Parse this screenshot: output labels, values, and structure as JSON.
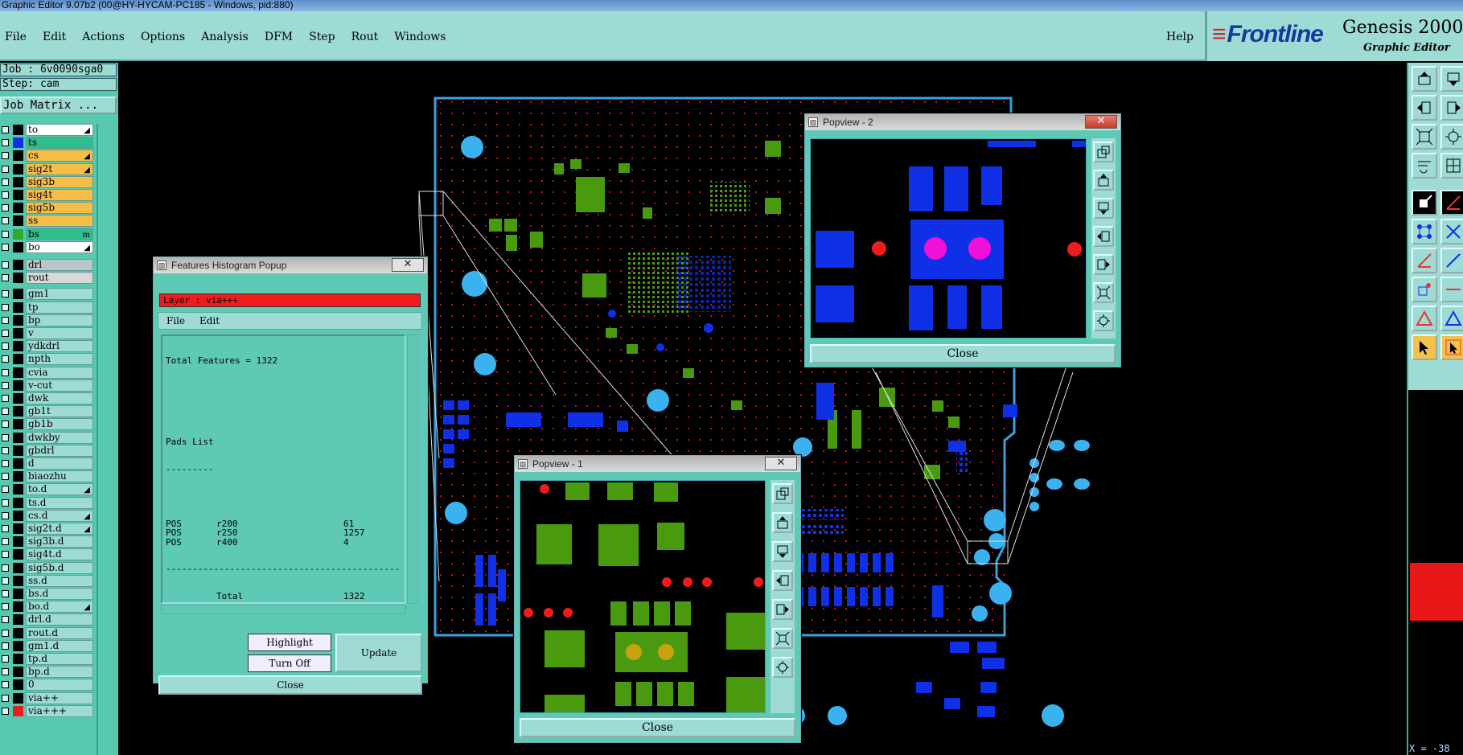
{
  "window": {
    "title": "Graphic Editor 9.07b2 (00@HY-HYCAM-PC185 - Windows, pid:880)"
  },
  "menu": {
    "items": [
      "File",
      "Edit",
      "Actions",
      "Options",
      "Analysis",
      "DFM",
      "Step",
      "Rout",
      "Windows"
    ],
    "help": "Help"
  },
  "branding": {
    "logo": "Frontline",
    "product": "Genesis 2000",
    "subtitle": "Graphic Editor"
  },
  "job": {
    "job_label": "Job : 6v0090sga0",
    "step_label": "Step: cam",
    "matrix_button": "Job Matrix ..."
  },
  "layers": [
    {
      "name": "to",
      "color": "#000000",
      "name_bg": "#ffffff",
      "mark": "◢"
    },
    {
      "name": "ts",
      "color": "#1030e8",
      "name_bg": "#2ebd8b",
      "mark": ""
    },
    {
      "name": "cs",
      "color": "#000000",
      "name_bg": "#f7be46",
      "mark": "◢"
    },
    {
      "name": "sig2t",
      "color": "#000000",
      "name_bg": "#f7be46",
      "mark": "◢"
    },
    {
      "name": "sig3b",
      "color": "#000000",
      "name_bg": "#f7be46",
      "mark": ""
    },
    {
      "name": "sig4t",
      "color": "#000000",
      "name_bg": "#f7be46",
      "mark": ""
    },
    {
      "name": "sig5b",
      "color": "#000000",
      "name_bg": "#f7be46",
      "mark": ""
    },
    {
      "name": "ss",
      "color": "#000000",
      "name_bg": "#f7be46",
      "mark": ""
    },
    {
      "name": "bs",
      "color": "#2eaa2e",
      "name_bg": "#2ebd8b",
      "mark": "m"
    },
    {
      "name": "bo",
      "color": "#000000",
      "name_bg": "#ffffff",
      "mark": "◢"
    },
    {
      "name": "drl",
      "color": "#000000",
      "name_bg": "#b8c8c8",
      "mark": ""
    },
    {
      "name": "rout",
      "color": "#000000",
      "name_bg": "#d8d8d8",
      "mark": ""
    },
    {
      "name": "gm1",
      "color": "#000000",
      "name_bg": "#9edbd4",
      "mark": ""
    },
    {
      "name": "tp",
      "color": "#000000",
      "name_bg": "#9edbd4",
      "mark": ""
    },
    {
      "name": "bp",
      "color": "#000000",
      "name_bg": "#9edbd4",
      "mark": ""
    },
    {
      "name": "v",
      "color": "#000000",
      "name_bg": "#9edbd4",
      "mark": ""
    },
    {
      "name": "ydkdrl",
      "color": "#000000",
      "name_bg": "#9edbd4",
      "mark": ""
    },
    {
      "name": "npth",
      "color": "#000000",
      "name_bg": "#9edbd4",
      "mark": ""
    },
    {
      "name": "cvia",
      "color": "#000000",
      "name_bg": "#9edbd4",
      "mark": ""
    },
    {
      "name": "v-cut",
      "color": "#000000",
      "name_bg": "#9edbd4",
      "mark": ""
    },
    {
      "name": "dwk",
      "color": "#000000",
      "name_bg": "#9edbd4",
      "mark": ""
    },
    {
      "name": "gb1t",
      "color": "#000000",
      "name_bg": "#9edbd4",
      "mark": ""
    },
    {
      "name": "gb1b",
      "color": "#000000",
      "name_bg": "#9edbd4",
      "mark": ""
    },
    {
      "name": "dwkby",
      "color": "#000000",
      "name_bg": "#9edbd4",
      "mark": ""
    },
    {
      "name": "gbdrl",
      "color": "#000000",
      "name_bg": "#9edbd4",
      "mark": ""
    },
    {
      "name": "d",
      "color": "#000000",
      "name_bg": "#9edbd4",
      "mark": ""
    },
    {
      "name": "biaozhu",
      "color": "#000000",
      "name_bg": "#9edbd4",
      "mark": ""
    },
    {
      "name": "to.d",
      "color": "#000000",
      "name_bg": "#9edbd4",
      "mark": "◢"
    },
    {
      "name": "ts.d",
      "color": "#000000",
      "name_bg": "#9edbd4",
      "mark": ""
    },
    {
      "name": "cs.d",
      "color": "#000000",
      "name_bg": "#9edbd4",
      "mark": "◢"
    },
    {
      "name": "sig2t.d",
      "color": "#000000",
      "name_bg": "#9edbd4",
      "mark": "◢"
    },
    {
      "name": "sig3b.d",
      "color": "#000000",
      "name_bg": "#9edbd4",
      "mark": ""
    },
    {
      "name": "sig4t.d",
      "color": "#000000",
      "name_bg": "#9edbd4",
      "mark": ""
    },
    {
      "name": "sig5b.d",
      "color": "#000000",
      "name_bg": "#9edbd4",
      "mark": ""
    },
    {
      "name": "ss.d",
      "color": "#000000",
      "name_bg": "#9edbd4",
      "mark": ""
    },
    {
      "name": "bs.d",
      "color": "#000000",
      "name_bg": "#9edbd4",
      "mark": ""
    },
    {
      "name": "bo.d",
      "color": "#000000",
      "name_bg": "#9edbd4",
      "mark": "◢"
    },
    {
      "name": "drl.d",
      "color": "#000000",
      "name_bg": "#9edbd4",
      "mark": ""
    },
    {
      "name": "rout.d",
      "color": "#000000",
      "name_bg": "#9edbd4",
      "mark": ""
    },
    {
      "name": "gm1.d",
      "color": "#000000",
      "name_bg": "#9edbd4",
      "mark": ""
    },
    {
      "name": "tp.d",
      "color": "#000000",
      "name_bg": "#9edbd4",
      "mark": ""
    },
    {
      "name": "bp.d",
      "color": "#000000",
      "name_bg": "#9edbd4",
      "mark": ""
    },
    {
      "name": "0",
      "color": "#000000",
      "name_bg": "#9edbd4",
      "mark": ""
    },
    {
      "name": "via++",
      "color": "#000000",
      "name_bg": "#9edbd4",
      "mark": ""
    },
    {
      "name": "via+++",
      "color": "#ee1c1c",
      "name_bg": "#9edbd4",
      "mark": ""
    }
  ],
  "histogram": {
    "title": "Features Histogram Popup",
    "layer_label": "Layer :  via+++",
    "menu": [
      "File",
      "Edit"
    ],
    "total_line": "Total Features = 1322",
    "list_title": "Pads List",
    "rows": [
      {
        "polarity": "POS",
        "symbol": "r200",
        "count": "61"
      },
      {
        "polarity": "POS",
        "symbol": "r250",
        "count": "1257"
      },
      {
        "polarity": "POS",
        "symbol": "r400",
        "count": "4"
      }
    ],
    "total_label": "Total",
    "total_value": "1322",
    "highlight_button": "Highlight",
    "turnoff_button": "Turn Off",
    "update_button": "Update",
    "close_button": "Close"
  },
  "popview1": {
    "title": "Popview - 1",
    "close_button": "Close"
  },
  "popview2": {
    "title": "Popview - 2",
    "close_button": "Close"
  },
  "status": {
    "coords": "X = -38"
  },
  "colors": {
    "board_outline": "#3aa0e0",
    "pad_blue": "#1030e8",
    "pad_green": "#4a9a10",
    "via_red": "#ee1c1c",
    "hole_cyan": "#3ab2f0",
    "panel_teal": "#56c9b0",
    "menu_bg": "#9edbd4"
  }
}
